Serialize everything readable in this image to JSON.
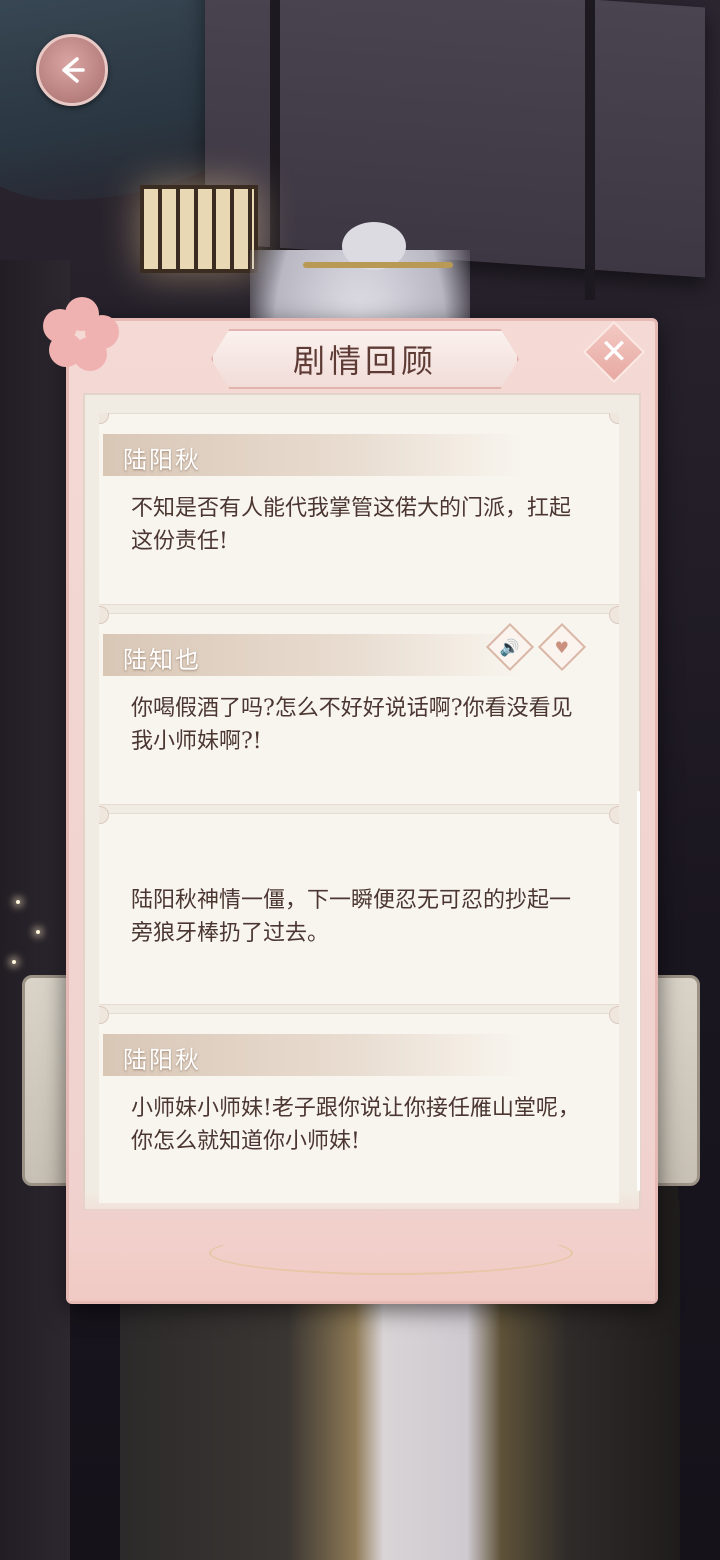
{
  "header": {
    "back_icon": "back-arrow-icon",
    "title": "剧情回顾",
    "close_icon": "close-icon",
    "close_glyph": "✕"
  },
  "entries": [
    {
      "speaker": "陆阳秋",
      "text": "不知是否有人能代我掌管这偌大的门派，扛起这份责任!",
      "has_actions": false
    },
    {
      "speaker": "陆知也",
      "text": "你喝假酒了吗?怎么不好好说话啊?你看没看见我小师妹啊?!",
      "has_actions": true,
      "actions": [
        {
          "icon": "speaker-icon",
          "glyph": "🔊"
        },
        {
          "icon": "heart-icon",
          "glyph": "♥"
        }
      ]
    },
    {
      "speaker": "",
      "text": "陆阳秋神情一僵，下一瞬便忍无可忍的抄起一旁狼牙棒扔了过去。",
      "has_actions": false
    },
    {
      "speaker": "陆阳秋",
      "text": "小师妹小师妹!老子跟你说让你接任雁山堂呢，你怎么就知道你小师妹!",
      "has_actions": false
    }
  ],
  "colors": {
    "panel": "#f4d9d5",
    "entry_bg": "#f8f5ee",
    "text": "#4b3631",
    "title": "#5e3b35"
  }
}
